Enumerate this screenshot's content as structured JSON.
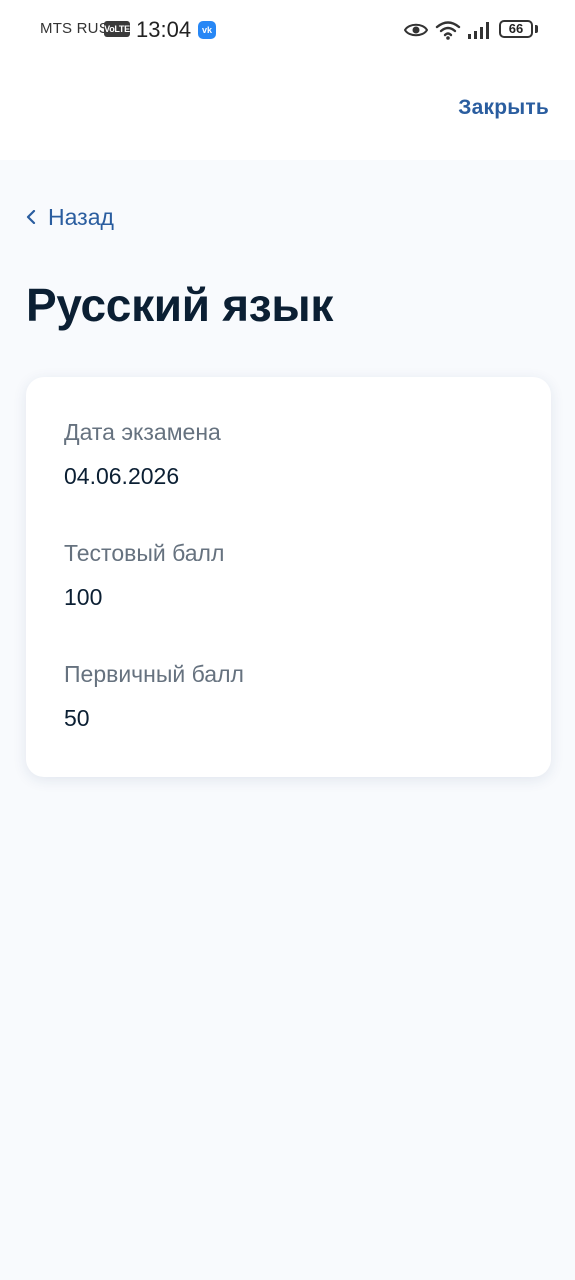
{
  "status_bar": {
    "carrier": "MTS RUS",
    "volte_badge": "VoLTE",
    "time": "13:04",
    "notification_app_icon": "vk-icon",
    "indicators": [
      "eye-icon",
      "wifi-icon",
      "signal-icon"
    ],
    "battery_level": "66"
  },
  "header": {
    "close_label": "Закрыть",
    "back_label": "Назад"
  },
  "page": {
    "title": "Русский язык"
  },
  "exam_card": {
    "fields": [
      {
        "label": "Дата экзамена",
        "value": "04.06.2026"
      },
      {
        "label": "Тестовый балл",
        "value": "100"
      },
      {
        "label": "Первичный балл",
        "value": "50"
      }
    ]
  },
  "colors": {
    "accent": "#2a5d9f",
    "title_text": "#0b1f33",
    "label_text": "#66727f",
    "page_background": "#f8fafd",
    "card_background": "#ffffff"
  }
}
